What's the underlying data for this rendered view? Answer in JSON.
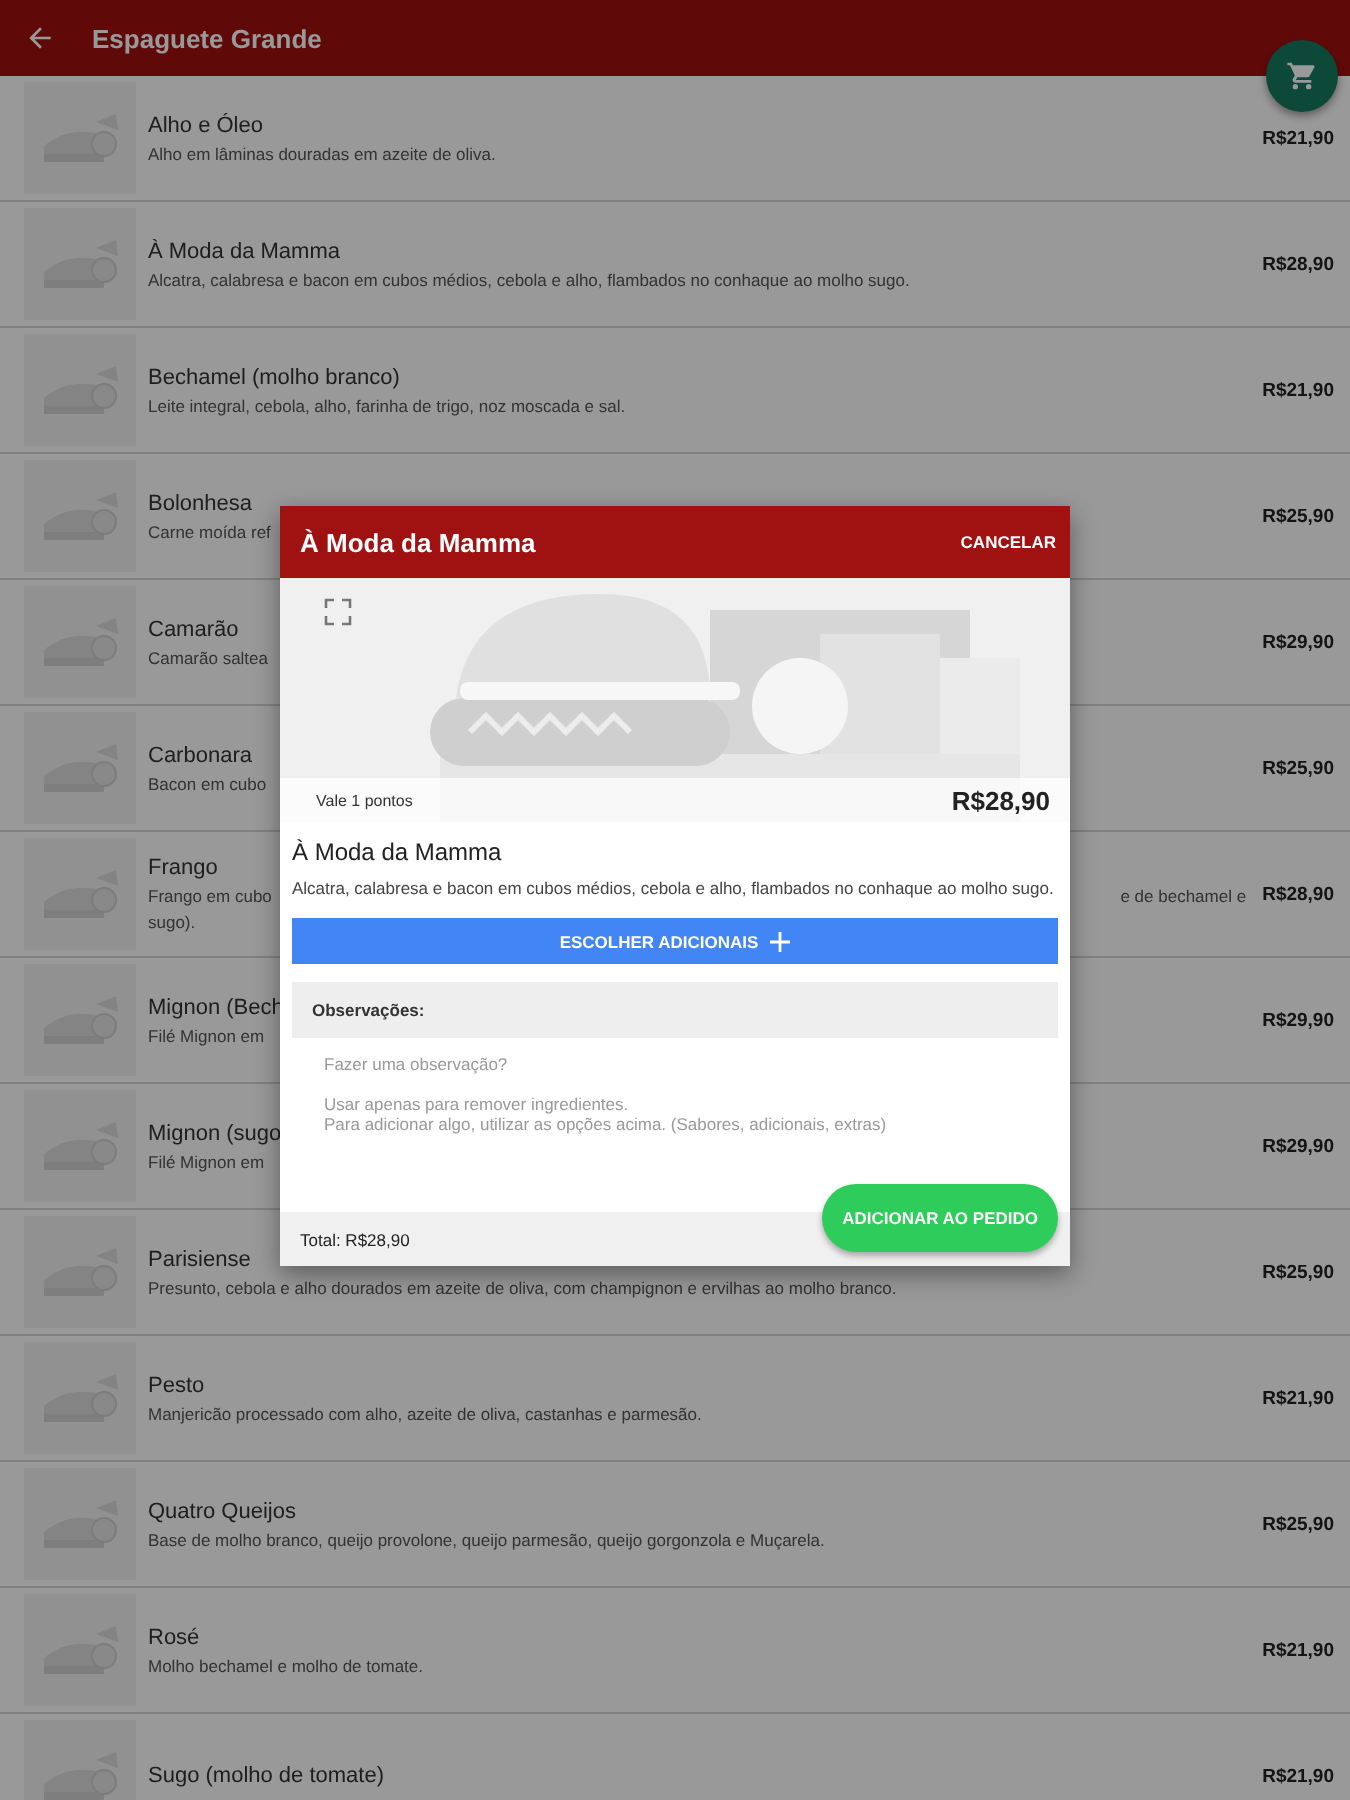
{
  "app_bar": {
    "title": "Espaguete Grande"
  },
  "items": [
    {
      "name": "Alho e Óleo",
      "description": "Alho em lâminas douradas em azeite de oliva.",
      "price": "R$21,90"
    },
    {
      "name": "À Moda da Mamma",
      "description": "Alcatra, calabresa e bacon em cubos médios, cebola e alho, flambados no conhaque ao molho sugo.",
      "price": "R$28,90"
    },
    {
      "name": "Bechamel (molho branco)",
      "description": "Leite integral, cebola, alho, farinha de trigo, noz moscada e sal.",
      "price": "R$21,90"
    },
    {
      "name": "Bolonhesa",
      "description": "Carne moída ref",
      "price": "R$25,90"
    },
    {
      "name": "Camarão",
      "description": "Camarão saltea",
      "price": "R$29,90"
    },
    {
      "name": "Carbonara",
      "description": "Bacon em cubo",
      "price": "R$25,90"
    },
    {
      "name": "Frango",
      "description": "Frango em cubo",
      "description_right": "e de bechamel e",
      "description_line2": "sugo).",
      "price": "R$28,90"
    },
    {
      "name": "Mignon (Bech",
      "description": "Filé Mignon em",
      "price": "R$29,90"
    },
    {
      "name": "Mignon (sugo",
      "description": "Filé Mignon em",
      "price": "R$29,90"
    },
    {
      "name": "Parisiense",
      "description": "Presunto, cebola e alho dourados em azeite de oliva, com champignon e ervilhas ao molho branco.",
      "price": "R$25,90"
    },
    {
      "name": "Pesto",
      "description": "Manjericão processado com alho, azeite de oliva, castanhas e parmesão.",
      "price": "R$21,90"
    },
    {
      "name": "Quatro Queijos",
      "description": "Base de molho branco, queijo provolone, queijo parmesão, queijo gorgonzola e Muçarela.",
      "price": "R$25,90"
    },
    {
      "name": "Rosé",
      "description": "Molho bechamel e molho de tomate.",
      "price": "R$21,90"
    },
    {
      "name": "Sugo (molho de tomate)",
      "price": "R$21,90"
    }
  ],
  "dialog": {
    "title": "À Moda da Mamma",
    "cancel": "CANCELAR",
    "points": "Vale 1 pontos",
    "price": "R$28,90",
    "name": "À Moda da Mamma",
    "description": "Alcatra, calabresa e bacon em cubos médios, cebola e alho, flambados no conhaque ao molho sugo.",
    "extras_button": "ESCOLHER ADICIONAIS",
    "notes_label": "Observações:",
    "notes_placeholder": "Fazer uma observação?\n\nUsar apenas para remover ingredientes.\nPara adicionar algo, utilizar as opções acima. (Sabores, adicionais, extras)",
    "total": "Total: R$28,90",
    "add_button": "ADICIONAR AO PEDIDO"
  }
}
